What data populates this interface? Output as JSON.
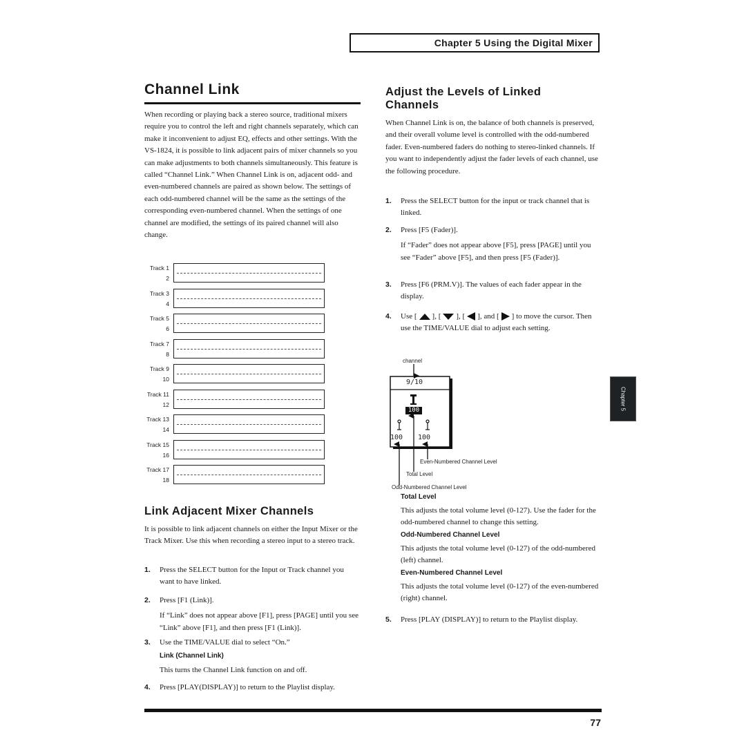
{
  "header": {
    "chapter_title": "Chapter 5 Using the Digital Mixer"
  },
  "channel_link": {
    "title": "Channel Link",
    "intro": "When recording or playing back a stereo source, traditional mixers require you to control the left and right channels separately, which can make it inconvenient to adjust EQ, effects and other settings. With the VS-1824, it is possible to link adjacent pairs of mixer channels so you can make adjustments to both channels simultaneously. This feature is called “Channel Link.” When Channel Link is on, adjacent odd- and even-numbered channels are paired as shown below. The settings of each odd-numbered channel will be the same as the settings of the corresponding even-numbered channel. When the settings of one channel are modified, the settings of its paired channel will also change.",
    "track_pairs": [
      {
        "odd": "Track 1",
        "even": "2"
      },
      {
        "odd": "Track 3",
        "even": "4"
      },
      {
        "odd": "Track 5",
        "even": "6"
      },
      {
        "odd": "Track 7",
        "even": "8"
      },
      {
        "odd": "Track 9",
        "even": "10"
      },
      {
        "odd": "Track 11",
        "even": "12"
      },
      {
        "odd": "Track 13",
        "even": "14"
      },
      {
        "odd": "Track 15",
        "even": "16"
      },
      {
        "odd": "Track 17",
        "even": "18"
      }
    ]
  },
  "link_adjacent": {
    "title": "Link Adjacent Mixer Channels",
    "intro": "It is possible to link adjacent channels on either the Input Mixer or the Track Mixer. Use this when recording a stereo input to a stereo track.",
    "steps": [
      {
        "num": "1.",
        "text": "Press the SELECT button for the Input or Track channel you want to have linked."
      },
      {
        "num": "2.",
        "text": "Press [F1 (Link)].",
        "note": "If “Link” does not appear above [F1], press [PAGE] until you see “Link” above [F1], and then press [F1 (Link)]."
      },
      {
        "num": "3.",
        "text": "Use the TIME/VALUE dial to select “On.”",
        "term": "Link (Channel Link)",
        "term_desc": "This turns the Channel Link function on and off."
      },
      {
        "num": "4.",
        "text": "Press [PLAY(DISPLAY)] to return to the Playlist display."
      }
    ]
  },
  "adjust_levels": {
    "title": "Adjust the Levels of Linked Channels",
    "intro": "When Channel Link is on, the balance of both channels is preserved, and their overall volume level is controlled with the odd-numbered fader. Even-numbered faders do nothing to stereo-linked channels. If you want to independently adjust the fader levels of each channel, use the following procedure.",
    "steps": [
      {
        "num": "1.",
        "text": "Press the SELECT button for the input or track channel that is linked."
      },
      {
        "num": "2.",
        "text": "Press [F5 (Fader)].",
        "note": "If “Fader” does not appear above [F5], press [PAGE] until you see “Fader” above [F5], and then press [F5 (Fader)]."
      },
      {
        "num": "3.",
        "text": "Press [F6 (PRM.V)]. The values of each fader appear in the display."
      },
      {
        "num": "4.",
        "text_before": "Use [",
        "sep1": "], [",
        "sep2": "], [",
        "sep3": "], and [",
        "text_after": "] to move the cursor. Then use the TIME/VALUE dial to adjust each setting.",
        "icons": [
          "up-arrow",
          "down-arrow",
          "left-arrow",
          "right-arrow"
        ]
      },
      {
        "num": "5.",
        "text": "Press [PLAY (DISPLAY)] to return to the Playlist display."
      }
    ],
    "diagram": {
      "channel_label": "channel",
      "channel_value": "9/10",
      "total_value": "100",
      "odd_value": "100",
      "even_value": "100",
      "even_label": "Even-Numbered Channel Level",
      "total_label": "Total Level",
      "odd_label": "Odd-Numbered Channel Level"
    },
    "terms": [
      {
        "head": "Total Level",
        "body": "This adjusts the total volume level (0-127). Use the fader for the odd-numbered channel to change this setting."
      },
      {
        "head": "Odd-Numbered Channel Level",
        "body": "This adjusts the total volume level (0-127) of the odd-numbered (left) channel."
      },
      {
        "head": "Even-Numbered Channel Level",
        "body": "This adjusts the total volume level (0-127) of the even-numbered (right) channel."
      }
    ]
  },
  "side_tab": {
    "label": "Chapter 5"
  },
  "footer": {
    "page_number": "77"
  }
}
